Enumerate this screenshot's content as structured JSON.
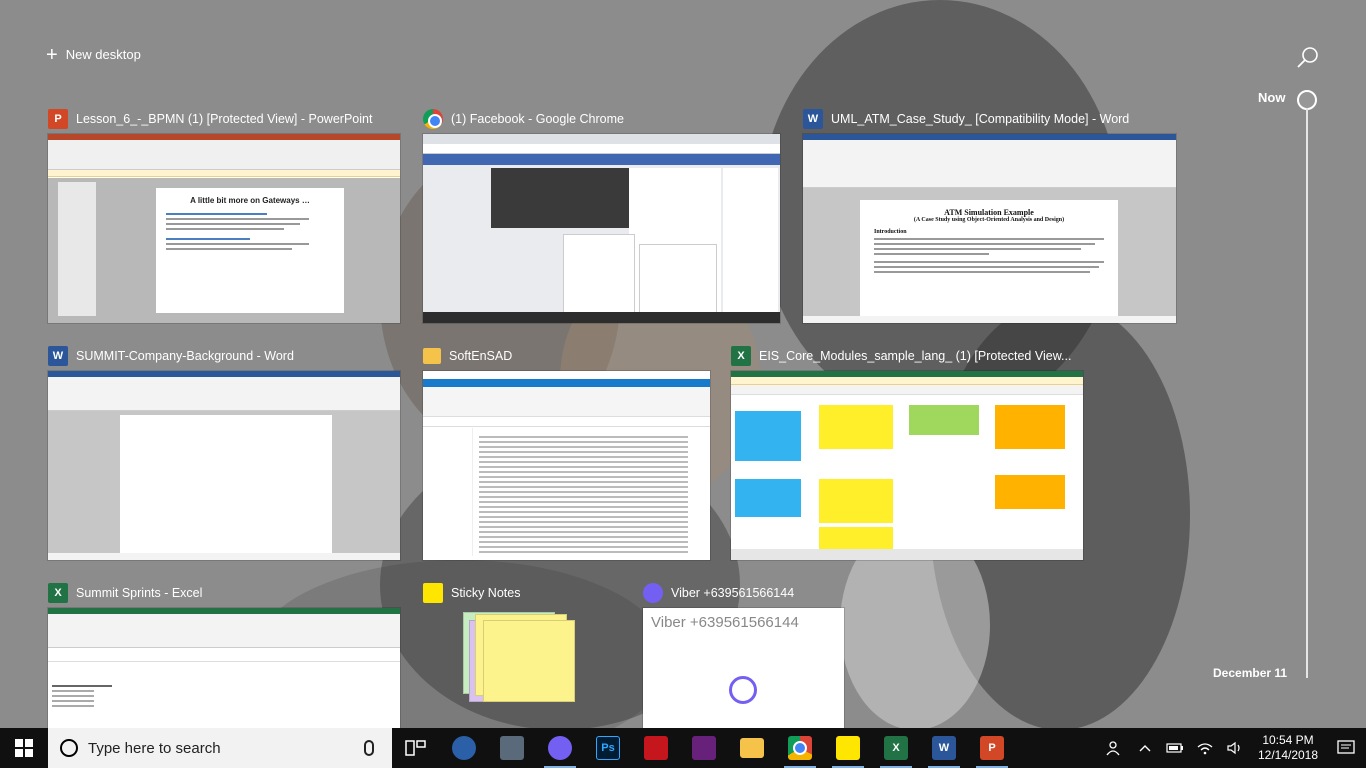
{
  "timeline": {
    "new_desktop_label": "New desktop",
    "now_label": "Now",
    "date_label": "December 11"
  },
  "windows": [
    {
      "app": "powerpoint-icon",
      "title": "Lesson_6_-_BPMN (1) [Protected View] - PowerPoint",
      "slide_title": "A little bit more on Gateways …"
    },
    {
      "app": "chrome-icon",
      "title": "(1) Facebook - Google Chrome"
    },
    {
      "app": "word-icon",
      "title": "UML_ATM_Case_Study_ [Compatibility Mode] - Word",
      "doc_title": "ATM Simulation Example",
      "doc_subtitle": "(A Case Study using Object-Oriented Analysis and Design)",
      "doc_heading": "Introduction"
    },
    {
      "app": "word-icon",
      "title": "SUMMIT-Company-Background - Word"
    },
    {
      "app": "folder-icon",
      "title": "SoftEnSAD"
    },
    {
      "app": "excel-icon",
      "title": "EIS_Core_Modules_sample_lang_ (1) [Protected View..."
    },
    {
      "app": "excel-icon",
      "title": "Summit Sprints - Excel"
    },
    {
      "app": "sticky-notes-icon",
      "title": "Sticky Notes"
    },
    {
      "app": "viber-icon",
      "title": "Viber +639561566144",
      "preview_text": "Viber +639561566144"
    }
  ],
  "taskbar": {
    "search_placeholder": "Type here to search",
    "time": "10:54 PM",
    "date": "12/14/2018",
    "pinned": [
      "task-view-icon",
      "app-icon",
      "tools-icon",
      "viber-icon",
      "photoshop-icon",
      "game-icon",
      "visual-studio-icon",
      "file-explorer-icon",
      "chrome-icon",
      "sticky-notes-icon",
      "excel-icon",
      "word-icon",
      "powerpoint-icon"
    ],
    "pinned_labels": {
      "photoshop": "Ps",
      "excel": "X",
      "word": "W",
      "powerpoint": "P"
    }
  },
  "colors": {
    "accent": "#7fb2e5",
    "powerpoint": "#d24726",
    "word": "#2b579a",
    "excel": "#217346"
  }
}
